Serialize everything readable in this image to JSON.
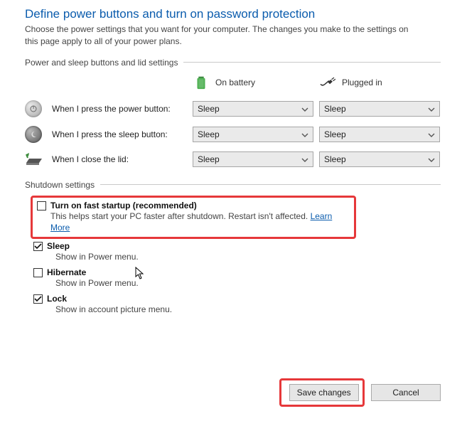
{
  "title": "Define power buttons and turn on password protection",
  "intro": "Choose the power settings that you want for your computer. The changes you make to the settings on this page apply to all of your power plans.",
  "section_buttons_header": "Power and sleep buttons and lid settings",
  "columns": {
    "battery": "On battery",
    "plugged": "Plugged in"
  },
  "rows": {
    "power_button_label": "When I press the power button:",
    "sleep_button_label": "When I press the sleep button:",
    "close_lid_label": "When I close the lid:"
  },
  "select_values": {
    "power_battery": "Sleep",
    "power_plugged": "Sleep",
    "sleep_battery": "Sleep",
    "sleep_plugged": "Sleep",
    "lid_battery": "Sleep",
    "lid_plugged": "Sleep"
  },
  "section_shutdown_header": "Shutdown settings",
  "shutdown": {
    "fast_startup": {
      "checked": false,
      "label": "Turn on fast startup (recommended)",
      "desc_prefix": "This helps start your PC faster after shutdown. Restart isn't affected. ",
      "learn_more": "Learn More"
    },
    "sleep": {
      "checked": true,
      "label": "Sleep",
      "desc": "Show in Power menu."
    },
    "hibernate": {
      "checked": false,
      "label": "Hibernate",
      "desc": "Show in Power menu."
    },
    "lock": {
      "checked": true,
      "label": "Lock",
      "desc": "Show in account picture menu."
    }
  },
  "buttons": {
    "save": "Save changes",
    "cancel": "Cancel"
  }
}
